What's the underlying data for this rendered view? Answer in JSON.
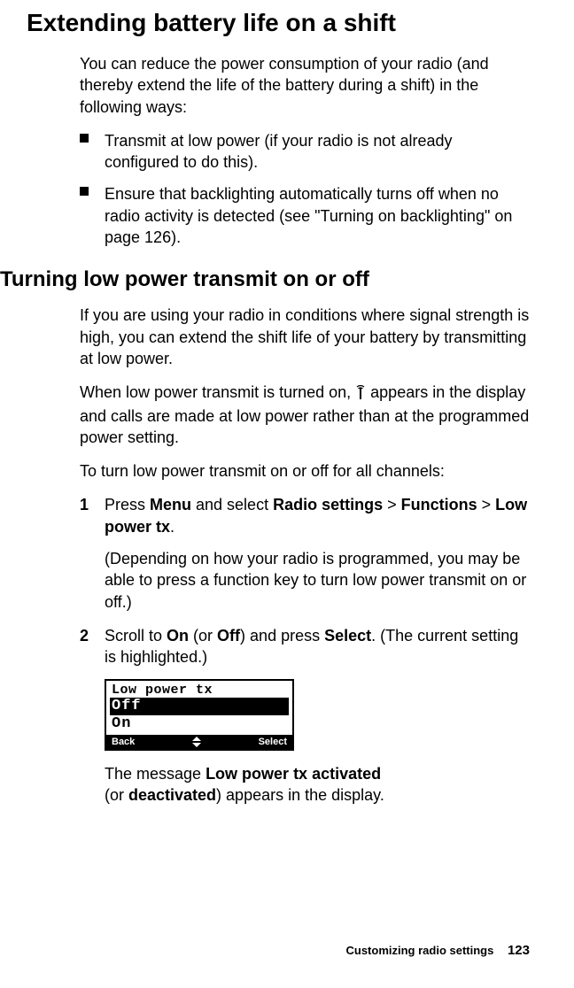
{
  "heading1": "Extending battery life on a shift",
  "intro": "You can reduce the power consumption of your radio (and thereby extend the life of the battery during a shift) in the following ways:",
  "bullets": [
    "Transmit at low power (if your radio is not already configured to do this).",
    "Ensure that backlighting automatically turns off when no radio activity is detected (see \"Turning on backlighting\" on page 126)."
  ],
  "heading2": "Turning low power transmit on or off",
  "para2a": "If you are using your radio in conditions where signal strength is high, you can extend the shift life of your battery by transmitting at low power.",
  "para2b_pre": "When low power transmit is turned on, ",
  "para2b_post": " appears in the display and calls are made at low power rather than at the programmed power setting.",
  "para2c": "To turn low power transmit on or off for all channels:",
  "step1_pre": "Press ",
  "step1_menu": "Menu",
  "step1_mid1": " and select ",
  "step1_rs": "Radio settings",
  "step1_gt1": " > ",
  "step1_fn": "Functions",
  "step1_gt2": " > ",
  "step1_lp": "Low power tx",
  "step1_end": ".",
  "step1_note": "(Depending on how your radio is programmed, you may be able to press a function key to turn low power transmit on or off.)",
  "step2_pre": "Scroll to ",
  "step2_on": "On",
  "step2_mid": " (or ",
  "step2_off": "Off",
  "step2_mid2": ") and press ",
  "step2_sel": "Select",
  "step2_end": ". (The current setting is highlighted.)",
  "radio": {
    "title": "Low power tx",
    "off": "Off",
    "on": "On",
    "back": "Back",
    "select": "Select"
  },
  "result_pre": "The message ",
  "result_b1": "Low power tx activated",
  "result_mid": " (or ",
  "result_b2": "deactivated",
  "result_end": ") appears in the display.",
  "footer_section": "Customizing radio settings",
  "footer_page": "123"
}
